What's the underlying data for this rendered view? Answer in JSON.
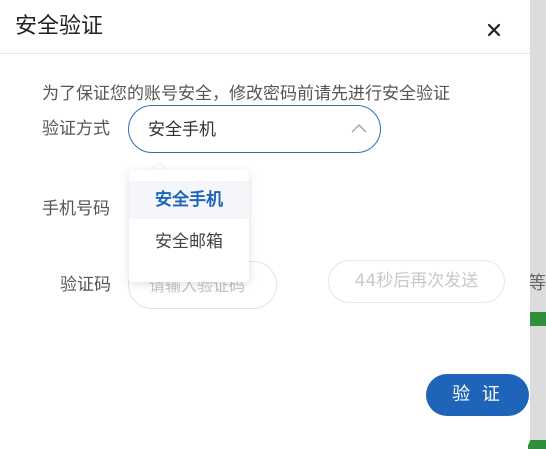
{
  "background_page": {
    "side_text": "等"
  },
  "modal": {
    "title": "安全验证",
    "notice": "为了保证您的账号安全，修改密码前请先进行安全验证",
    "method_label": "验证方式",
    "method_selected": "安全手机",
    "phone_label": "手机号码",
    "code_label": "验证码",
    "code_placeholder": "请输入验证码",
    "resend_label": "44秒后再次发送",
    "submit_label": "验 证"
  },
  "dropdown": {
    "options": [
      "安全手机",
      "安全邮箱"
    ],
    "selected_index": 0
  },
  "colors": {
    "accent": "#1e64b8",
    "select_border": "#2d6fb4",
    "disabled_text": "#c8c8c8"
  }
}
